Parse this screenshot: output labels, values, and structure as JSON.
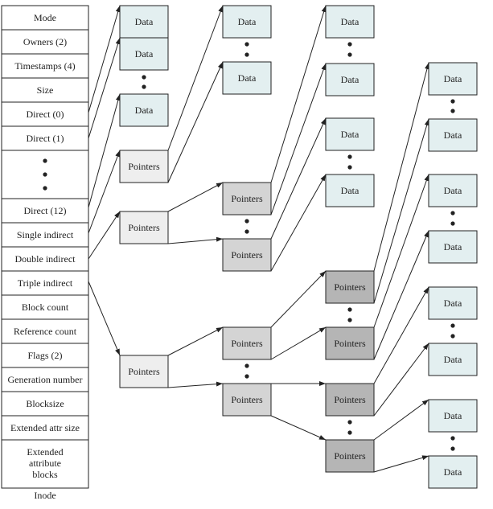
{
  "inode": {
    "caption": "Inode",
    "fields": [
      "Mode",
      "Owners (2)",
      "Timestamps (4)",
      "Size",
      "Direct (0)",
      "Direct (1)",
      "",
      "Direct (12)",
      "Single indirect",
      "Double indirect",
      "Triple indirect",
      "Block count",
      "Reference count",
      "Flags (2)",
      "Generation number",
      "Blocksize",
      "Extended attr size",
      "Extended attribute blocks"
    ]
  },
  "block_labels": {
    "data": "Data",
    "pointers": "Pointers"
  },
  "colors": {
    "data_block": "#e3eff0",
    "pointers_level1": "#eeeeee",
    "pointers_level2": "#d4d4d4",
    "pointers_level3": "#b5b5b5",
    "line": "#222222"
  }
}
